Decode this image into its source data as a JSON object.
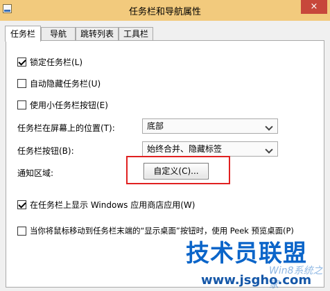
{
  "window": {
    "title": "任务栏和导航属性",
    "close_label": "×"
  },
  "tabs": [
    {
      "label": "任务栏",
      "active": true
    },
    {
      "label": "导航",
      "active": false
    },
    {
      "label": "跳转列表",
      "active": false
    },
    {
      "label": "工具栏",
      "active": false
    }
  ],
  "options": {
    "lock": {
      "label": "锁定任务栏(L)",
      "checked": true
    },
    "autohide": {
      "label": "自动隐藏任务栏(U)",
      "checked": false
    },
    "small": {
      "label": "使用小任务栏按钮(E)",
      "checked": false
    }
  },
  "position": {
    "label": "任务栏在屏幕上的位置(T):",
    "value": "底部"
  },
  "buttons": {
    "label": "任务栏按钮(B):",
    "value": "始终合并、隐藏标签"
  },
  "notification": {
    "label": "通知区域:",
    "customize": "自定义(C)..."
  },
  "store": {
    "label": "在任务栏上显示 Windows 应用商店应用(W)",
    "checked": true
  },
  "peek": {
    "label": "当你将鼠标移动到任务栏末端的“显示桌面”按钮时，使用 Peek 预览桌面(P)",
    "checked": false
  },
  "watermark": {
    "logo": "技术员联盟",
    "sub": "Win8系统之家",
    "url": "www.jsgho.com"
  },
  "colors": {
    "titlebar": "#f2ca7d",
    "highlight": "#e02020",
    "watermark": "#0b65c9"
  }
}
